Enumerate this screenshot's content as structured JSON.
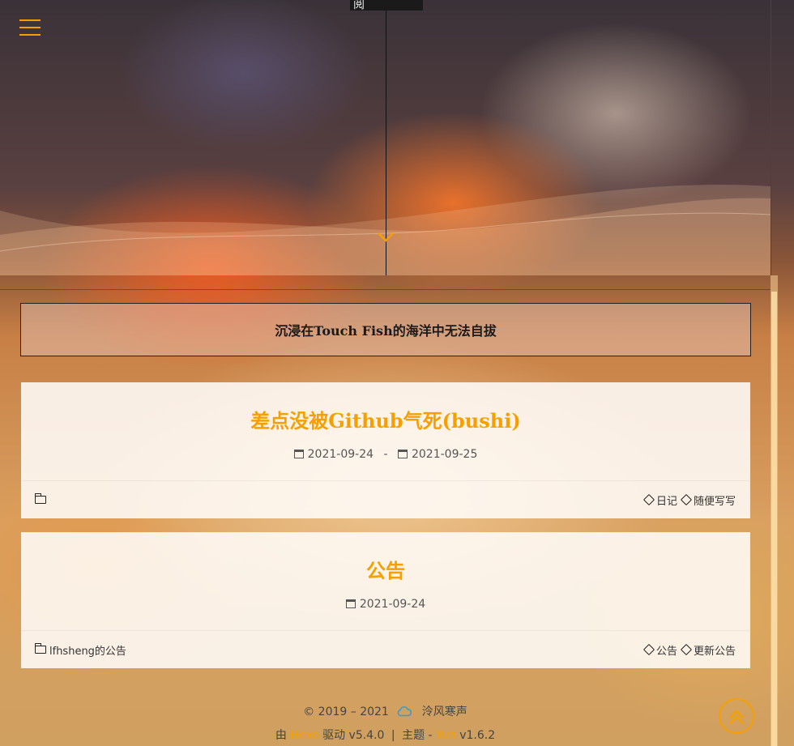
{
  "hero": {
    "top_label": "阅"
  },
  "notice": {
    "text": "沉浸在Touch Fish的海洋中无法自拔"
  },
  "posts": [
    {
      "title": "差点没被Github气死(bushi)",
      "created": "2021-09-24",
      "separator": "-",
      "updated": "2021-09-25",
      "category": "",
      "tags": [
        "日记",
        "随便写写"
      ]
    },
    {
      "title": "公告",
      "created": "2021-09-24",
      "category": "lfhsheng的公告",
      "tags": [
        "公告",
        "更新公告"
      ]
    }
  ],
  "footer": {
    "copyright": "© 2019 – 2021",
    "author": "泠风寒声",
    "powered_prefix": "由",
    "powered_by": "Hexo",
    "powered_suffix": "驱动 v5.4.0",
    "sep": "|",
    "theme_prefix": "主题 -",
    "theme": "Yun",
    "theme_version": "v1.6.2"
  },
  "colors": {
    "accent": "#f5a000",
    "cloud": "#3a9ad9"
  },
  "icons": [
    "menu-icon",
    "chevron-down-icon",
    "calendar-icon",
    "calendar-edit-icon",
    "folder-icon",
    "tag-icon",
    "cloud-icon",
    "back-to-top-icon"
  ]
}
